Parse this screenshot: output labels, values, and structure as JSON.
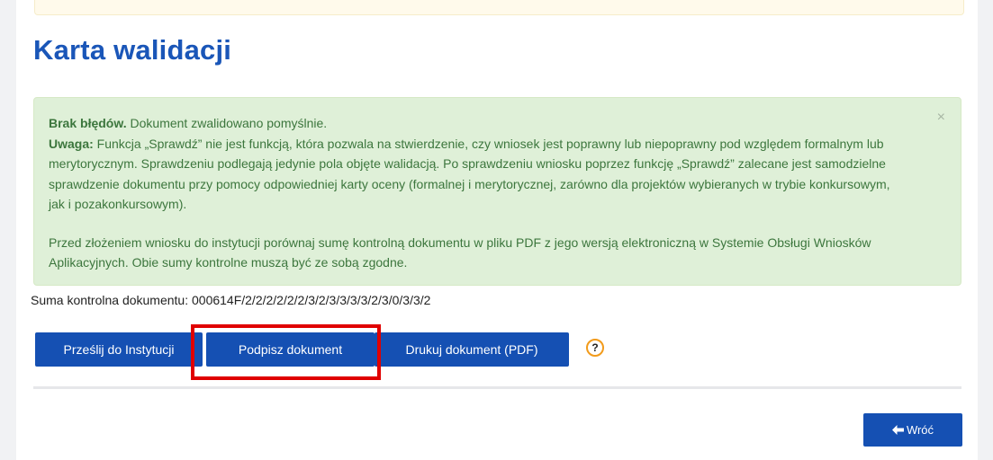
{
  "page": {
    "title": "Karta walidacji"
  },
  "alert": {
    "close_symbol": "×",
    "status_bold": "Brak błędów.",
    "status_text": " Dokument zwalidowano pomyślnie.",
    "note_bold": "Uwaga:",
    "note_text": " Funkcja „Sprawdź” nie jest funkcją, która pozwala na stwierdzenie, czy wniosek jest poprawny lub niepoprawny pod względem formalnym lub merytorycznym. Sprawdzeniu podlegają jedynie pola objęte walidacją. Po sprawdzeniu wniosku poprzez funkcję „Sprawdź” zalecane jest samodzielne sprawdzenie dokumentu przy pomocy odpowiedniej karty oceny (formalnej i merytorycznej, zarówno dla projektów wybieranych w trybie konkursowym, jak i pozakonkursowym).",
    "checksum_note": "Przed złożeniem wniosku do instytucji porównaj sumę kontrolną dokumentu w pliku PDF z jego wersją elektroniczną w Systemie Obsługi Wniosków Aplikacyjnych. Obie sumy kontrolne muszą być ze sobą zgodne."
  },
  "checksum": {
    "text": "Suma kontrolna dokumentu: 000614F/2/2/2/2/2/2/3/2/3/3/3/3/2/3/0/3/3/2"
  },
  "actions": {
    "send_label": "Prześlij do Instytucji",
    "sign_label": "Podpisz dokument",
    "print_label": "Drukuj dokument (PDF)",
    "help_symbol": "?"
  },
  "footer": {
    "back_label": "Wróć"
  },
  "colors": {
    "title": "#1a56b8",
    "button": "#1550b3",
    "alert_bg": "#dff0d8",
    "alert_text": "#3c763d",
    "highlight": "#e00000",
    "help_ring": "#f29b1b"
  }
}
